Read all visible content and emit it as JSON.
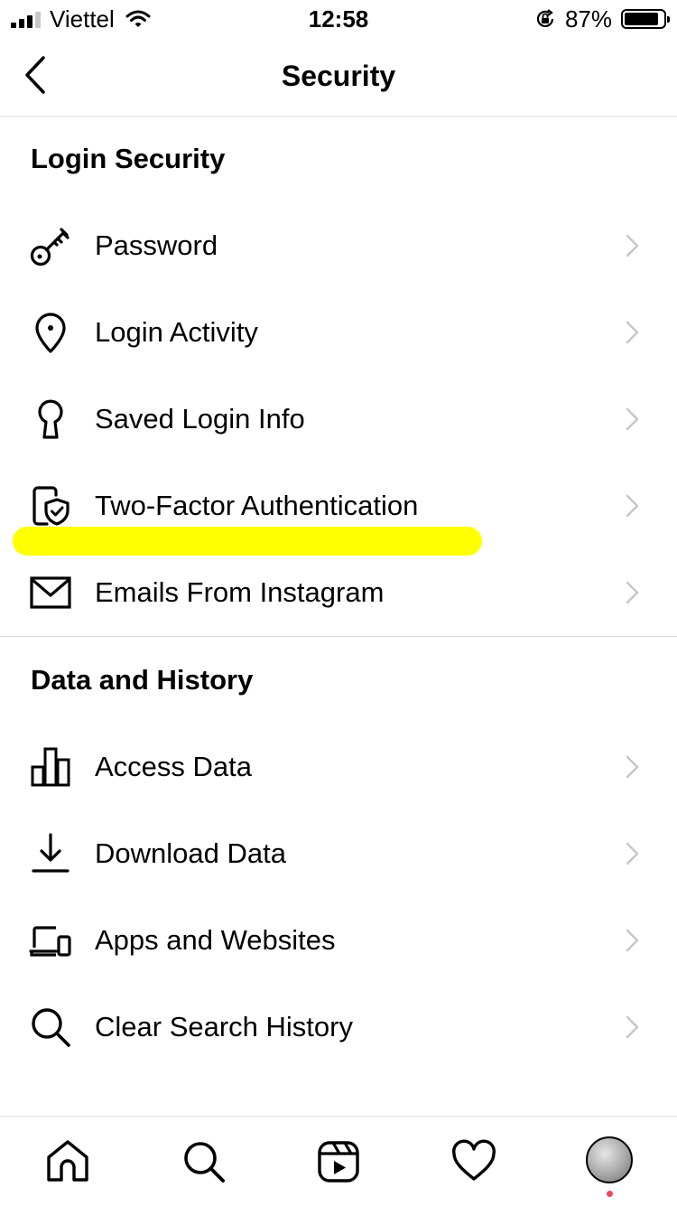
{
  "status_bar": {
    "carrier": "Viettel",
    "time": "12:58",
    "battery_percent_text": "87%",
    "battery_level": 0.87
  },
  "header": {
    "title": "Security"
  },
  "sections": [
    {
      "title": "Login Security",
      "items": [
        {
          "label": "Password",
          "icon": "key-icon"
        },
        {
          "label": "Login Activity",
          "icon": "location-pin-icon"
        },
        {
          "label": "Saved Login Info",
          "icon": "keyhole-icon"
        },
        {
          "label": "Two-Factor Authentication",
          "icon": "phone-shield-icon"
        },
        {
          "label": "Emails From Instagram",
          "icon": "envelope-icon"
        }
      ]
    },
    {
      "title": "Data and History",
      "items": [
        {
          "label": "Access Data",
          "icon": "bar-chart-icon"
        },
        {
          "label": "Download Data",
          "icon": "download-icon"
        },
        {
          "label": "Apps and Websites",
          "icon": "devices-icon"
        },
        {
          "label": "Clear Search History",
          "icon": "search-icon"
        }
      ]
    }
  ],
  "tab_bar": [
    "home-icon",
    "search-icon",
    "reels-icon",
    "heart-icon",
    "profile-avatar"
  ],
  "colors": {
    "highlight": "#ffff00",
    "divider": "#dbdbdb",
    "chevron": "#c7c7c7",
    "notification": "#ed4956"
  }
}
